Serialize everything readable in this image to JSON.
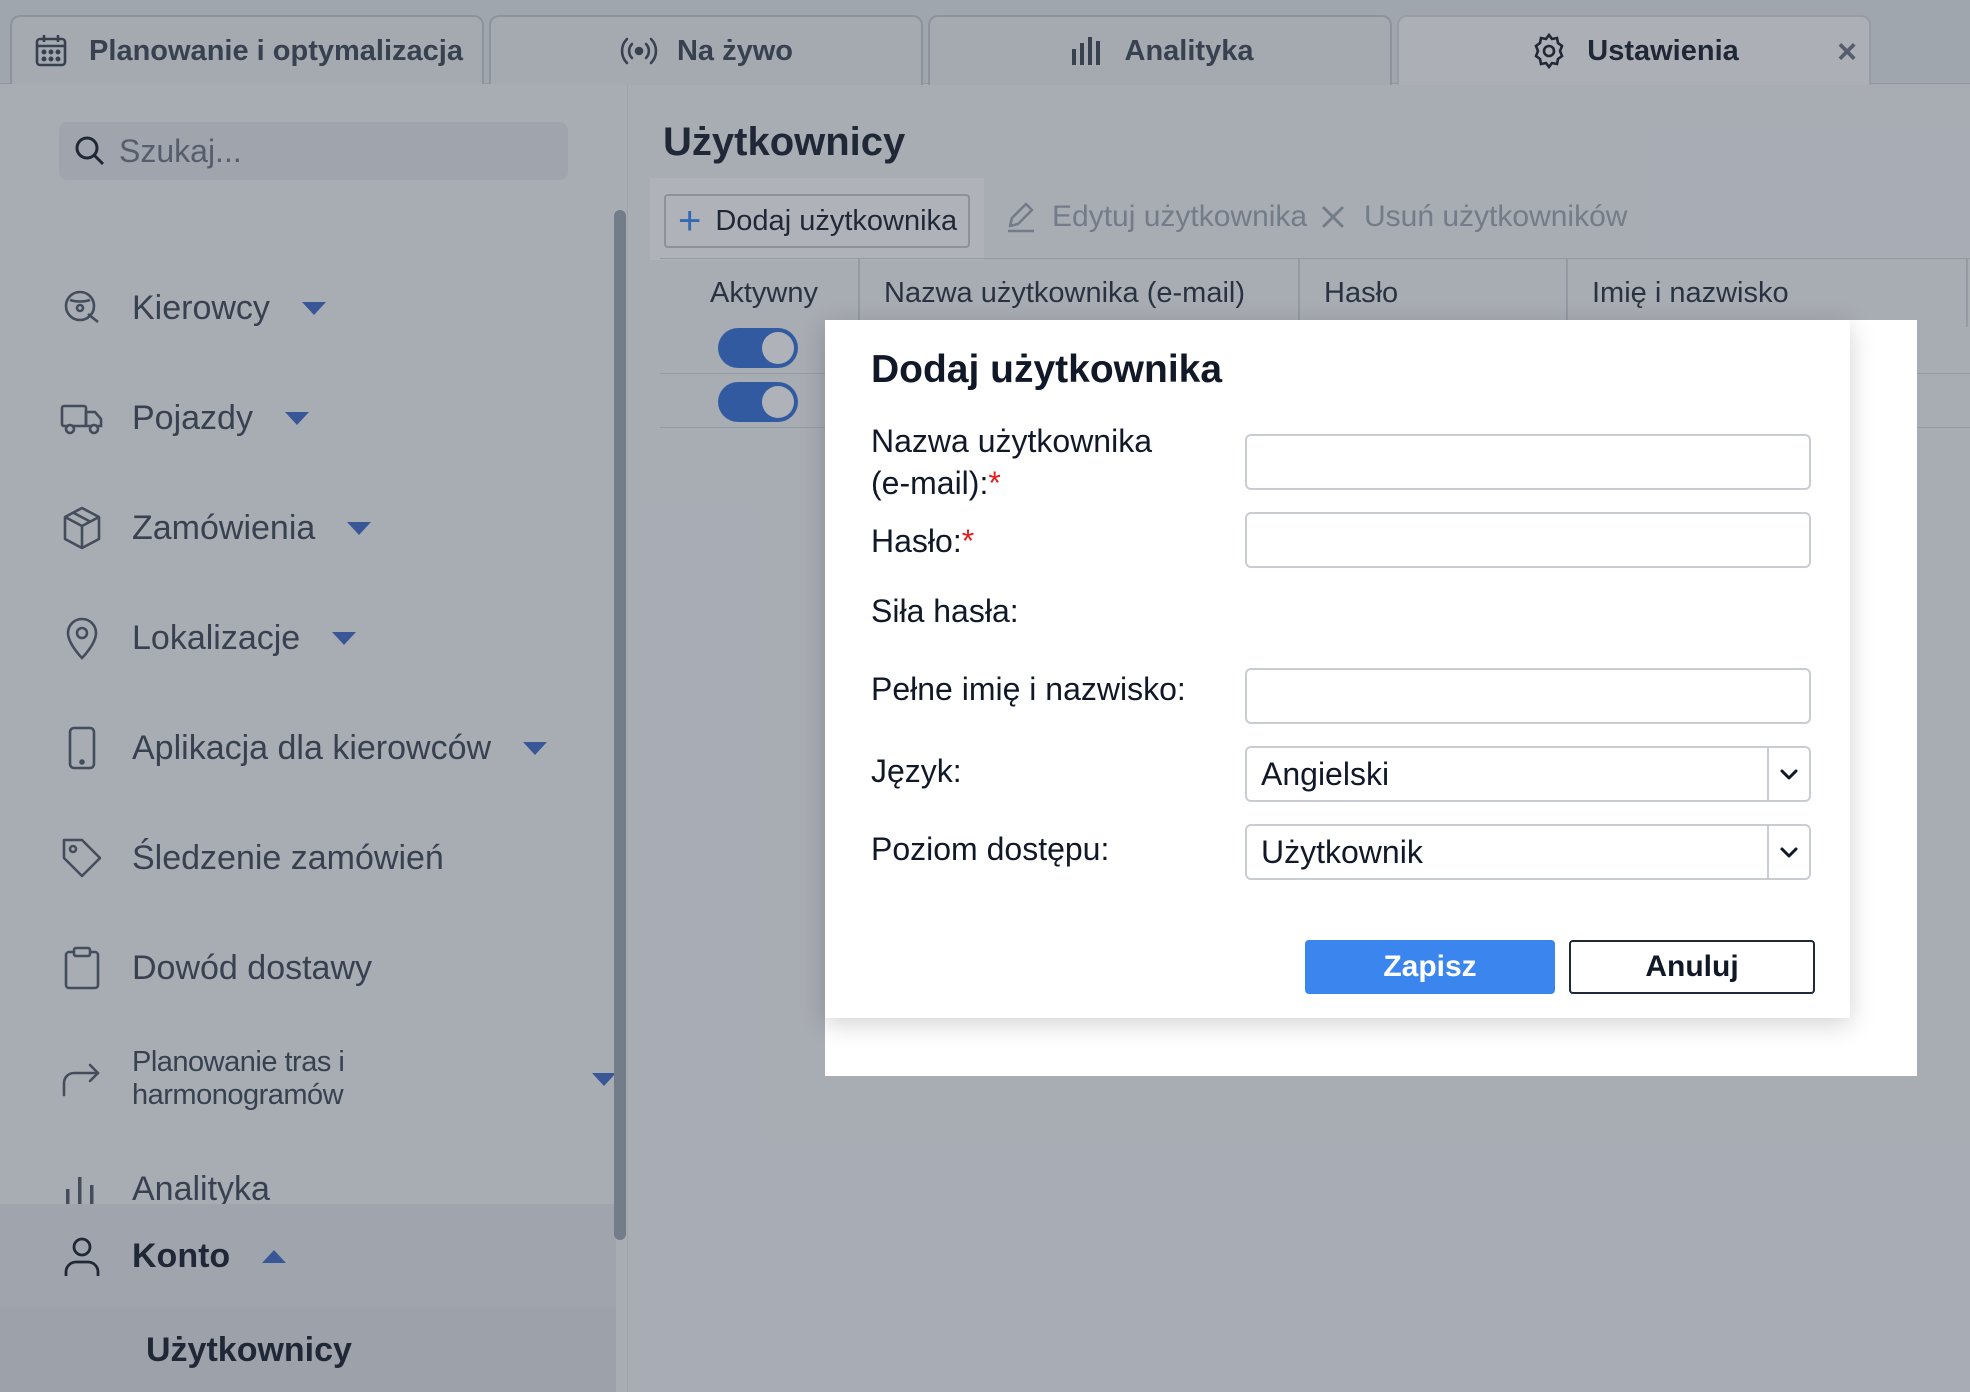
{
  "tabs": [
    {
      "label": "Planowanie i optymalizacja",
      "icon": "calendar-icon"
    },
    {
      "label": "Na żywo",
      "icon": "broadcast-icon"
    },
    {
      "label": "Analityka",
      "icon": "bar-chart-icon"
    },
    {
      "label": "Ustawienia",
      "icon": "gear-icon",
      "active": true
    }
  ],
  "tab_close": "×",
  "sidebar": {
    "search_placeholder": "Szukaj...",
    "items": [
      {
        "label": "Kierowcy",
        "icon": "driver-icon",
        "expandable": true
      },
      {
        "label": "Pojazdy",
        "icon": "truck-icon",
        "expandable": true
      },
      {
        "label": "Zamówienia",
        "icon": "box-icon",
        "expandable": true
      },
      {
        "label": "Lokalizacje",
        "icon": "map-pin-icon",
        "expandable": true
      },
      {
        "label": "Aplikacja dla kierowców",
        "icon": "phone-icon",
        "expandable": true
      },
      {
        "label": "Śledzenie zamówień",
        "icon": "tag-icon",
        "expandable": false
      },
      {
        "label": "Dowód dostawy",
        "icon": "clipboard-icon",
        "expandable": false
      },
      {
        "label": "Planowanie tras i harmonogramów",
        "icon": "route-arrow-icon",
        "expandable": true
      },
      {
        "label": "Analityka",
        "icon": "bar-chart-icon",
        "expandable": false
      },
      {
        "label": "Konto",
        "icon": "user-icon",
        "expandable": true,
        "expanded": true
      }
    ],
    "subitem": "Użytkownicy"
  },
  "main": {
    "title": "Użytkownicy",
    "toolbar": {
      "add": "Dodaj użytkownika",
      "edit": "Edytuj użytkownika",
      "delete": "Usuń użytkowników"
    },
    "columns": [
      "Aktywny",
      "Nazwa użytkownika (e-mail)",
      "Hasło",
      "Imię i nazwisko"
    ]
  },
  "modal": {
    "title": "Dodaj użytkownika",
    "username_label_1": "Nazwa użytkownika",
    "username_label_2": "(e-mail):",
    "password_label": "Hasło:",
    "required_mark": "*",
    "strength_label": "Siła hasła:",
    "fullname_label": "Pełne imię i nazwisko:",
    "language_label": "Język:",
    "language_value": "Angielski",
    "access_label": "Poziom dostępu:",
    "access_value": "Użytkownik",
    "save": "Zapisz",
    "cancel": "Anuluj"
  },
  "colors": {
    "accent": "#3b86ee",
    "toggle_on": "#2f6bd8",
    "required": "#e11d1d"
  }
}
